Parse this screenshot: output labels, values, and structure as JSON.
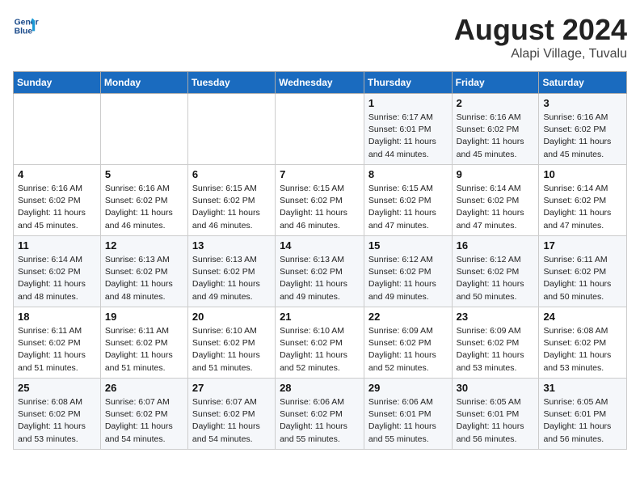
{
  "header": {
    "logo_line1": "General",
    "logo_line2": "Blue",
    "title": "August 2024",
    "subtitle": "Alapi Village, Tuvalu"
  },
  "days_of_week": [
    "Sunday",
    "Monday",
    "Tuesday",
    "Wednesday",
    "Thursday",
    "Friday",
    "Saturday"
  ],
  "weeks": [
    [
      {
        "day": "",
        "sunrise": "",
        "sunset": "",
        "daylight": "",
        "empty": true
      },
      {
        "day": "",
        "sunrise": "",
        "sunset": "",
        "daylight": "",
        "empty": true
      },
      {
        "day": "",
        "sunrise": "",
        "sunset": "",
        "daylight": "",
        "empty": true
      },
      {
        "day": "",
        "sunrise": "",
        "sunset": "",
        "daylight": "",
        "empty": true
      },
      {
        "day": "1",
        "sunrise": "Sunrise: 6:17 AM",
        "sunset": "Sunset: 6:01 PM",
        "daylight": "Daylight: 11 hours and 44 minutes."
      },
      {
        "day": "2",
        "sunrise": "Sunrise: 6:16 AM",
        "sunset": "Sunset: 6:02 PM",
        "daylight": "Daylight: 11 hours and 45 minutes."
      },
      {
        "day": "3",
        "sunrise": "Sunrise: 6:16 AM",
        "sunset": "Sunset: 6:02 PM",
        "daylight": "Daylight: 11 hours and 45 minutes."
      }
    ],
    [
      {
        "day": "4",
        "sunrise": "Sunrise: 6:16 AM",
        "sunset": "Sunset: 6:02 PM",
        "daylight": "Daylight: 11 hours and 45 minutes."
      },
      {
        "day": "5",
        "sunrise": "Sunrise: 6:16 AM",
        "sunset": "Sunset: 6:02 PM",
        "daylight": "Daylight: 11 hours and 46 minutes."
      },
      {
        "day": "6",
        "sunrise": "Sunrise: 6:15 AM",
        "sunset": "Sunset: 6:02 PM",
        "daylight": "Daylight: 11 hours and 46 minutes."
      },
      {
        "day": "7",
        "sunrise": "Sunrise: 6:15 AM",
        "sunset": "Sunset: 6:02 PM",
        "daylight": "Daylight: 11 hours and 46 minutes."
      },
      {
        "day": "8",
        "sunrise": "Sunrise: 6:15 AM",
        "sunset": "Sunset: 6:02 PM",
        "daylight": "Daylight: 11 hours and 47 minutes."
      },
      {
        "day": "9",
        "sunrise": "Sunrise: 6:14 AM",
        "sunset": "Sunset: 6:02 PM",
        "daylight": "Daylight: 11 hours and 47 minutes."
      },
      {
        "day": "10",
        "sunrise": "Sunrise: 6:14 AM",
        "sunset": "Sunset: 6:02 PM",
        "daylight": "Daylight: 11 hours and 47 minutes."
      }
    ],
    [
      {
        "day": "11",
        "sunrise": "Sunrise: 6:14 AM",
        "sunset": "Sunset: 6:02 PM",
        "daylight": "Daylight: 11 hours and 48 minutes."
      },
      {
        "day": "12",
        "sunrise": "Sunrise: 6:13 AM",
        "sunset": "Sunset: 6:02 PM",
        "daylight": "Daylight: 11 hours and 48 minutes."
      },
      {
        "day": "13",
        "sunrise": "Sunrise: 6:13 AM",
        "sunset": "Sunset: 6:02 PM",
        "daylight": "Daylight: 11 hours and 49 minutes."
      },
      {
        "day": "14",
        "sunrise": "Sunrise: 6:13 AM",
        "sunset": "Sunset: 6:02 PM",
        "daylight": "Daylight: 11 hours and 49 minutes."
      },
      {
        "day": "15",
        "sunrise": "Sunrise: 6:12 AM",
        "sunset": "Sunset: 6:02 PM",
        "daylight": "Daylight: 11 hours and 49 minutes."
      },
      {
        "day": "16",
        "sunrise": "Sunrise: 6:12 AM",
        "sunset": "Sunset: 6:02 PM",
        "daylight": "Daylight: 11 hours and 50 minutes."
      },
      {
        "day": "17",
        "sunrise": "Sunrise: 6:11 AM",
        "sunset": "Sunset: 6:02 PM",
        "daylight": "Daylight: 11 hours and 50 minutes."
      }
    ],
    [
      {
        "day": "18",
        "sunrise": "Sunrise: 6:11 AM",
        "sunset": "Sunset: 6:02 PM",
        "daylight": "Daylight: 11 hours and 51 minutes."
      },
      {
        "day": "19",
        "sunrise": "Sunrise: 6:11 AM",
        "sunset": "Sunset: 6:02 PM",
        "daylight": "Daylight: 11 hours and 51 minutes."
      },
      {
        "day": "20",
        "sunrise": "Sunrise: 6:10 AM",
        "sunset": "Sunset: 6:02 PM",
        "daylight": "Daylight: 11 hours and 51 minutes."
      },
      {
        "day": "21",
        "sunrise": "Sunrise: 6:10 AM",
        "sunset": "Sunset: 6:02 PM",
        "daylight": "Daylight: 11 hours and 52 minutes."
      },
      {
        "day": "22",
        "sunrise": "Sunrise: 6:09 AM",
        "sunset": "Sunset: 6:02 PM",
        "daylight": "Daylight: 11 hours and 52 minutes."
      },
      {
        "day": "23",
        "sunrise": "Sunrise: 6:09 AM",
        "sunset": "Sunset: 6:02 PM",
        "daylight": "Daylight: 11 hours and 53 minutes."
      },
      {
        "day": "24",
        "sunrise": "Sunrise: 6:08 AM",
        "sunset": "Sunset: 6:02 PM",
        "daylight": "Daylight: 11 hours and 53 minutes."
      }
    ],
    [
      {
        "day": "25",
        "sunrise": "Sunrise: 6:08 AM",
        "sunset": "Sunset: 6:02 PM",
        "daylight": "Daylight: 11 hours and 53 minutes."
      },
      {
        "day": "26",
        "sunrise": "Sunrise: 6:07 AM",
        "sunset": "Sunset: 6:02 PM",
        "daylight": "Daylight: 11 hours and 54 minutes."
      },
      {
        "day": "27",
        "sunrise": "Sunrise: 6:07 AM",
        "sunset": "Sunset: 6:02 PM",
        "daylight": "Daylight: 11 hours and 54 minutes."
      },
      {
        "day": "28",
        "sunrise": "Sunrise: 6:06 AM",
        "sunset": "Sunset: 6:02 PM",
        "daylight": "Daylight: 11 hours and 55 minutes."
      },
      {
        "day": "29",
        "sunrise": "Sunrise: 6:06 AM",
        "sunset": "Sunset: 6:01 PM",
        "daylight": "Daylight: 11 hours and 55 minutes."
      },
      {
        "day": "30",
        "sunrise": "Sunrise: 6:05 AM",
        "sunset": "Sunset: 6:01 PM",
        "daylight": "Daylight: 11 hours and 56 minutes."
      },
      {
        "day": "31",
        "sunrise": "Sunrise: 6:05 AM",
        "sunset": "Sunset: 6:01 PM",
        "daylight": "Daylight: 11 hours and 56 minutes."
      }
    ]
  ]
}
